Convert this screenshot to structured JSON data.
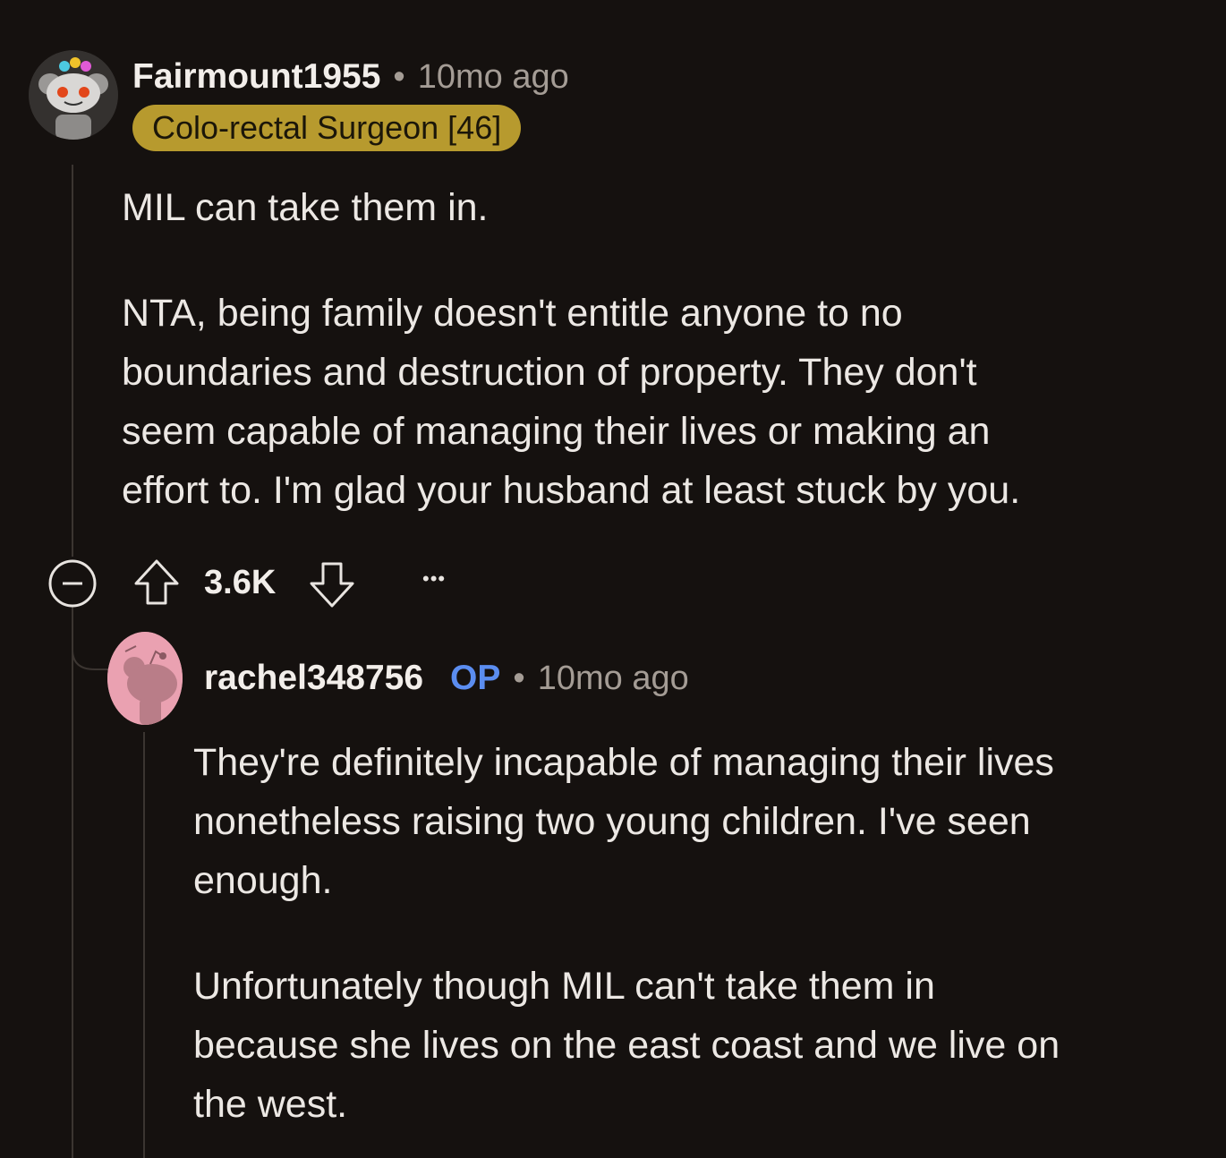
{
  "comment": {
    "author": "Fairmount1955",
    "time": "10mo ago",
    "separator": "•",
    "flair": "Colo-rectal Surgeon [46]",
    "body": [
      "MIL can take them in.",
      "NTA, being family doesn't entitle anyone to no",
      "boundaries and destruction of property. They don't",
      "seem capable of managing their lives or making an",
      "effort to. I'm glad your husband at least stuck by you."
    ],
    "votes": "3.6K",
    "more": "•••"
  },
  "reply": {
    "author": "rachel348756",
    "op_tag": "OP",
    "separator": "•",
    "time": "10mo ago",
    "body": [
      "They're definitely incapable of managing their lives",
      "nonetheless raising two young children. I've seen",
      "enough.",
      "Unfortunately though MIL can't take them in",
      "because she lives on the east coast and we live on",
      "the west."
    ]
  },
  "colors": {
    "background": "#15110f",
    "flair_bg": "#b79a2e",
    "op_blue": "#5b8df0",
    "thread_line": "#3b3531"
  },
  "icons": [
    "collapse-icon",
    "upvote-icon",
    "downvote-icon",
    "more-options-icon"
  ]
}
